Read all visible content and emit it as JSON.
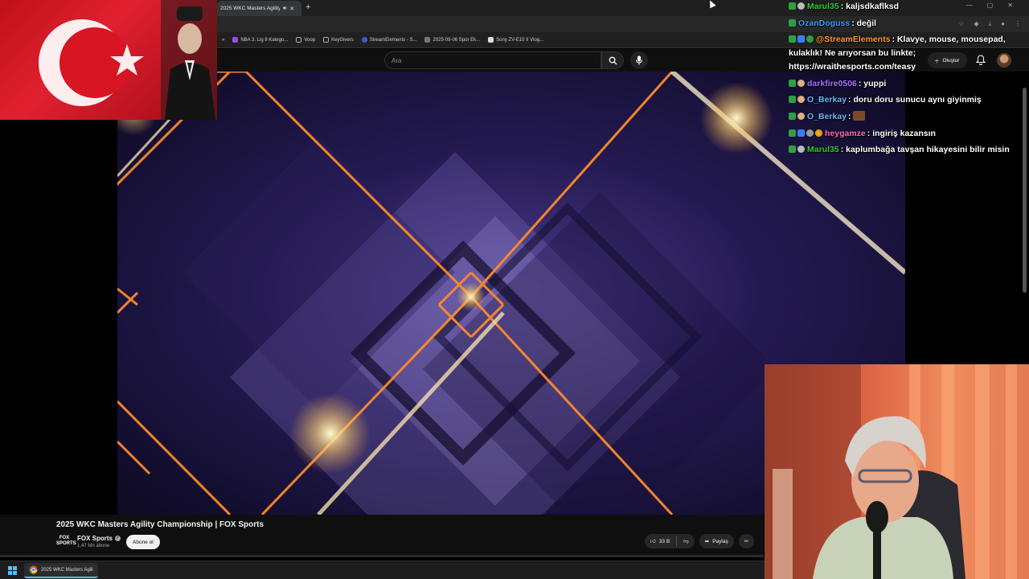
{
  "browser": {
    "tab_title": "2025 WKC Masters Agility",
    "new_tab_label": "+",
    "window_controls": [
      "—",
      "▢",
      "✕"
    ]
  },
  "bookmarks": [
    {
      "label": "NBA 3. Lig 8 Katego...",
      "color": "#9b4de0"
    },
    {
      "label": "Voop",
      "color": "#555555"
    },
    {
      "label": "KeyGivers",
      "color": "#555555"
    },
    {
      "label": "StreamElements - S...",
      "color": "#3f5ad6"
    },
    {
      "label": "2025-09-06 Spor Ek...",
      "color": "#777777"
    },
    {
      "label": "Sony ZV-E10 II Vlog...",
      "color": "#dddddd"
    }
  ],
  "youtube": {
    "search_placeholder": "Ara",
    "create_label": "Oluştur",
    "video_title": "2025 WKC Masters Agility Championship | FOX Sports",
    "channel_logo_text": "FOX SPORTS",
    "channel_name": "FOX Sports",
    "subscriber_count": "1,47 Mn abone",
    "subscribe_label": "Abone ol",
    "like_count": "33 B",
    "share_label": "Paylaş"
  },
  "taskbar": {
    "app_label": "2025 WKC Masters Agili"
  },
  "chat": {
    "messages": [
      {
        "user": "Marul35",
        "color": "#33cc33",
        "text": ": kaljsdkaflksd",
        "badges": [
          "#2ea043",
          "#bbbbbb"
        ]
      },
      {
        "user": "OzanDoguss",
        "color": "#3d9bff",
        "text": ": değil",
        "badges": [
          "#2ea043"
        ]
      },
      {
        "user": "@StreamElements",
        "color": "#ff9933",
        "text": ": Klavye, mouse, mousepad, kulaklık! Ne arıyorsan bu linkte; https://wraithesports.com/teasy",
        "badges": [
          "#2ea043",
          "#3d7bff",
          "#2ea043"
        ]
      },
      {
        "user": "darkfire0506",
        "color": "#a970ff",
        "text": ": yuppi",
        "badges": [
          "#2ea043",
          "#e0b080"
        ]
      },
      {
        "user": "O_Berkay",
        "color": "#66bbff",
        "text": ": doru doru sunucu aynı giyinmiş",
        "badges": [
          "#2ea043",
          "#e0b080"
        ]
      },
      {
        "user": "O_Berkay",
        "color": "#66bbff",
        "text": ":",
        "badges": [
          "#2ea043",
          "#e0b080"
        ],
        "emote": true
      },
      {
        "user": "heygamze",
        "color": "#ff69b4",
        "text": ": ingiriş kazansın",
        "badges": [
          "#2ea043",
          "#3d7bff",
          "#999999",
          "#f0a000"
        ]
      },
      {
        "user": "Marul35",
        "color": "#33cc33",
        "text": ": kaplumbağa tavşan hikayesini bilir misin",
        "badges": [
          "#2ea043",
          "#bbbbbb"
        ]
      }
    ]
  },
  "colors": {
    "yt_background": "#0f0f0f",
    "flag_red": "#e30a17",
    "accent_orange": "#ff9933",
    "video_purple": "#3a2a78"
  }
}
